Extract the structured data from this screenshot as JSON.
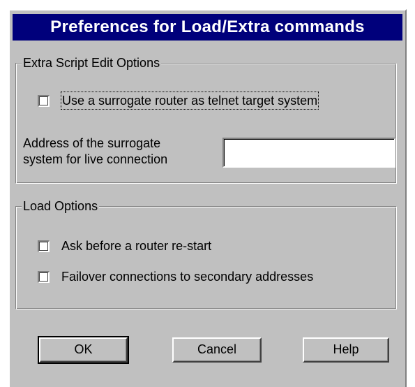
{
  "window": {
    "title": "Preferences for Load/Extra commands"
  },
  "extra_group": {
    "legend": "Extra Script Edit Options",
    "surrogate_checkbox": {
      "label": "Use a surrogate router as telnet target system",
      "checked": false
    },
    "address": {
      "label_line1": "Address of the surrogate",
      "label_line2": "system for live connection",
      "value": ""
    }
  },
  "load_group": {
    "legend": "Load Options",
    "restart_checkbox": {
      "label": "Ask before a router re-start",
      "checked": false
    },
    "failover_checkbox": {
      "label": "Failover connections to secondary addresses",
      "checked": false
    }
  },
  "buttons": {
    "ok": "OK",
    "cancel": "Cancel",
    "help": "Help"
  },
  "colors": {
    "title_bar": "#00007b",
    "dialog_face": "#c0c0c0"
  }
}
